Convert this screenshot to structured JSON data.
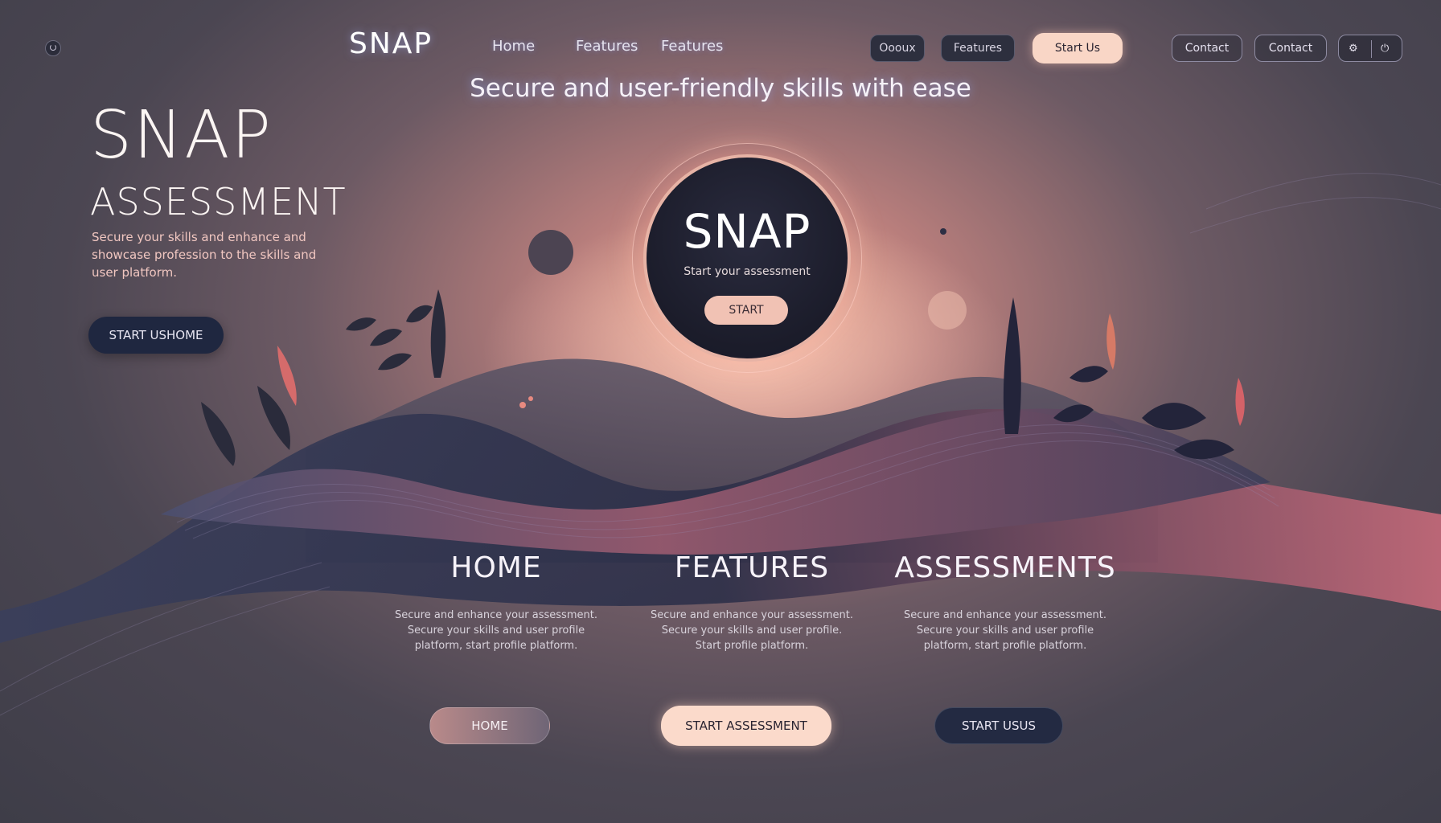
{
  "nav": {
    "brand": "SNAP",
    "links": [
      "Home",
      "Features",
      "Features"
    ],
    "buttons": [
      "Oooux",
      "Features",
      "Start Us",
      "Contact",
      "Contact"
    ],
    "icon_names": [
      "settings-icon",
      "power-icon"
    ]
  },
  "tagline": "Secure and user-friendly skills with ease",
  "hero": {
    "title": "SNAP",
    "subtitle": "ASSESSMENT",
    "description": "Secure your skills and enhance and showcase profession to the skills and user platform.",
    "button": "START USHOME"
  },
  "center": {
    "title": "SNAP",
    "subtitle": "Start your assessment",
    "button": "START"
  },
  "columns": [
    {
      "title": "HOME",
      "text": "Secure and enhance your assessment. Secure your skills and user profile platform, start profile platform.",
      "button": "HOME"
    },
    {
      "title": "FEATURES",
      "text": "Secure and enhance your assessment. Secure your skills and user profile. Start profile platform.",
      "button": "START ASSESSMENT"
    },
    {
      "title": "ASSESSMENTS",
      "text": "Secure and enhance your assessment. Secure your skills and user profile platform, start profile platform.",
      "button": "START USUS"
    }
  ],
  "colors": {
    "accent_peach": "#f9d6c6",
    "dark_navy": "#1f2740",
    "background": "#4b4652"
  }
}
